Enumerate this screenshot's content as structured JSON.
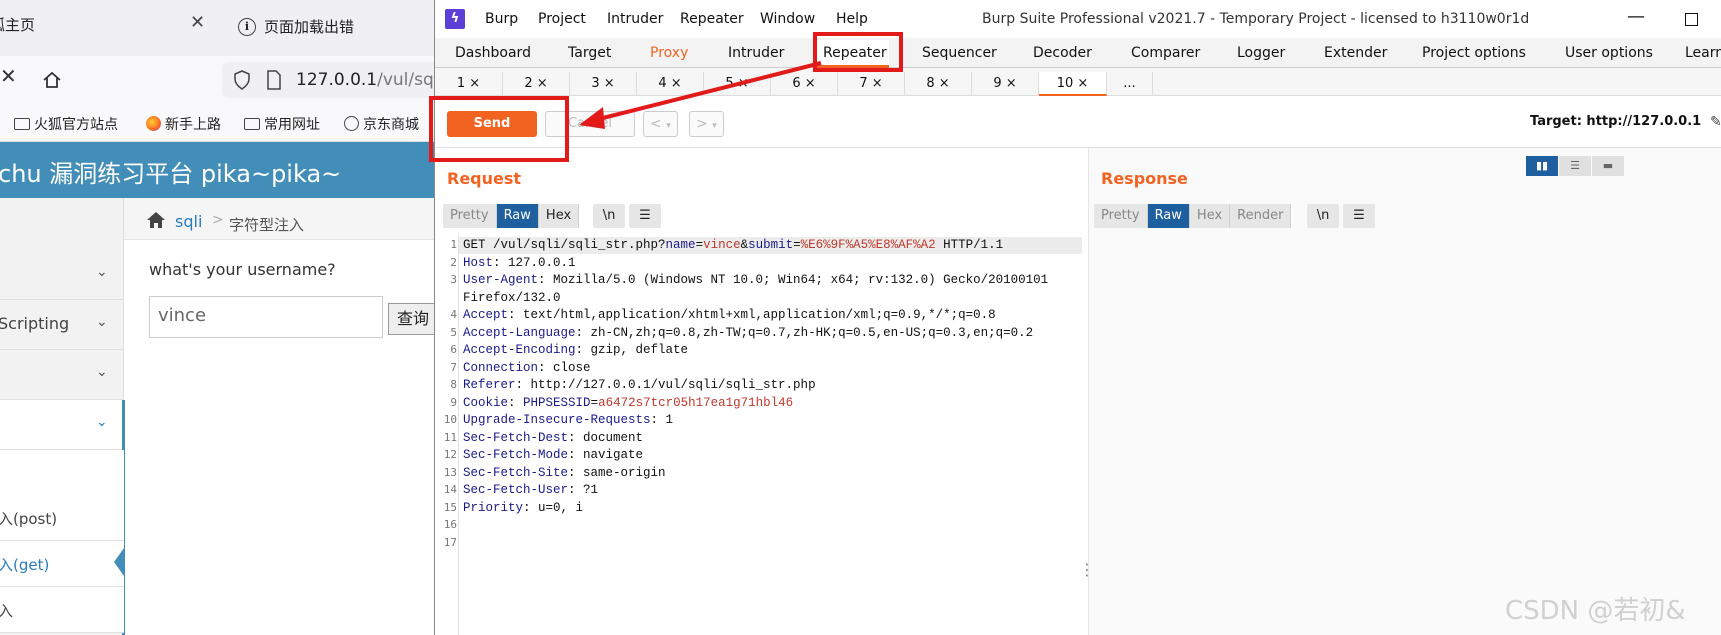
{
  "browser": {
    "tab1_label": "狐主页",
    "tab2_label": "页面加载出错",
    "url_host": "127.0.0.1",
    "url_path": "/vul/sql",
    "bookmarks": [
      "火狐官方站点",
      "新手上路",
      "常用网址",
      "京东商城"
    ],
    "site_title": "chu 漏洞练习平台 pika~pika~",
    "breadcrumb": {
      "link": "sqli",
      "sep": ">",
      "current": "字符型注入"
    },
    "sidebar": [
      {
        "label": ""
      },
      {
        "label": "Scripting"
      },
      {
        "label": ""
      },
      {
        "label": ""
      },
      {
        "label": ""
      },
      {
        "label": "入(post)"
      },
      {
        "label": "入(get)"
      },
      {
        "label": "入"
      }
    ],
    "form": {
      "label": "what's your username?",
      "value": "vince",
      "button": "查询"
    }
  },
  "burp": {
    "menu": [
      "Burp",
      "Project",
      "Intruder",
      "Repeater",
      "Window",
      "Help"
    ],
    "window_title": "Burp Suite Professional v2021.7 - Temporary Project - licensed to h3110w0r1d",
    "main_tabs": [
      "Dashboard",
      "Target",
      "Proxy",
      "Intruder",
      "Repeater",
      "Sequencer",
      "Decoder",
      "Comparer",
      "Logger",
      "Extender",
      "Project options",
      "User options",
      "Learn"
    ],
    "sub_tabs": [
      "1 ×",
      "2 ×",
      "3 ×",
      "4 ×",
      "5 ×",
      "6 ×",
      "7 ×",
      "8 ×",
      "9 ×",
      "10 ×",
      "..."
    ],
    "send_label": "Send",
    "cancel_label": "Cancel",
    "back_label": "<",
    "forward_label": ">",
    "target_label": "Target: http://127.0.0.1",
    "request": {
      "title": "Request",
      "view_tabs": [
        "Pretty",
        "Raw",
        "Hex"
      ],
      "newline_label": "\\n",
      "line_numbers": [
        "1",
        "2",
        "3",
        "",
        "4",
        "5",
        "6",
        "7",
        "8",
        "9",
        "10",
        "11",
        "12",
        "13",
        "14",
        "15",
        "16",
        "17"
      ],
      "lines": [
        {
          "k": "GET /vul/sqli/sqli_str.php?",
          "v": ""
        },
        {
          "k": "Host",
          "v": ": 127.0.0.1"
        },
        {
          "k": "User-Agent",
          "v": ": Mozilla/5.0 (Windows NT 10.0; Win64; x64; rv:132.0) Gecko/20100101"
        },
        {
          "k": "",
          "v": "Firefox/132.0"
        },
        {
          "k": "Accept",
          "v": ": text/html,application/xhtml+xml,application/xml;q=0.9,*/*;q=0.8"
        },
        {
          "k": "Accept-Language",
          "v": ": zh-CN,zh;q=0.8,zh-TW;q=0.7,zh-HK;q=0.5,en-US;q=0.3,en;q=0.2"
        },
        {
          "k": "Accept-Encoding",
          "v": ": gzip, deflate"
        },
        {
          "k": "Connection",
          "v": ": close"
        },
        {
          "k": "Referer",
          "v": ": http://127.0.0.1/vul/sqli/sqli_str.php"
        },
        {
          "k": "Cookie",
          "v": ": "
        },
        {
          "k": "Upgrade-Insecure-Requests",
          "v": ": 1"
        },
        {
          "k": "Sec-Fetch-Dest",
          "v": ": document"
        },
        {
          "k": "Sec-Fetch-Mode",
          "v": ": navigate"
        },
        {
          "k": "Sec-Fetch-Site",
          "v": ": same-origin"
        },
        {
          "k": "Sec-Fetch-User",
          "v": ": ?1"
        },
        {
          "k": "Priority",
          "v": ": u=0, i"
        },
        {
          "k": "",
          "v": ""
        },
        {
          "k": "",
          "v": ""
        }
      ],
      "line1": {
        "method_path": "GET /vul/sqli/sqli_str.php?",
        "p1": "name",
        "eq": "=",
        "v1": "vince",
        "amp": "&",
        "p2": "submit",
        "v2": "%E6%9F%A5%E8%AF%A2",
        "proto": " HTTP/1.1"
      },
      "cookie": {
        "name": "PHPSESSID",
        "value": "a6472s7tcr05h17ea1g71hbl46"
      }
    },
    "response": {
      "title": "Response",
      "view_tabs": [
        "Pretty",
        "Raw",
        "Hex",
        "Render"
      ],
      "newline_label": "\\n"
    }
  },
  "watermark": "CSDN @若初&",
  "colors": {
    "accent": "#f26322",
    "selected_tab": "#1e5fa0",
    "highlight_box": "#e31a1a",
    "pika_header": "#438eb9"
  }
}
